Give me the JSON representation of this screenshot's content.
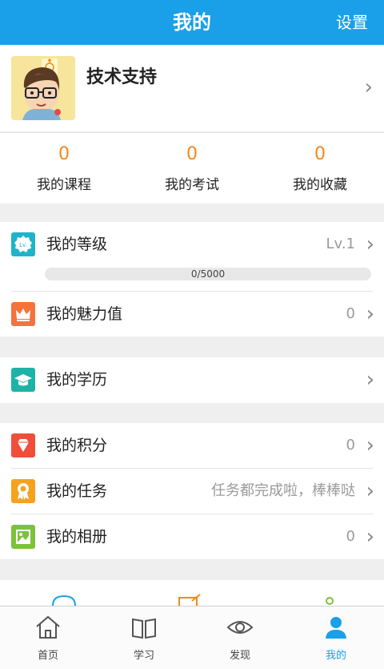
{
  "header": {
    "title": "我的",
    "settings_label": "设置"
  },
  "profile": {
    "name": "技术支持"
  },
  "stats": [
    {
      "value": "0",
      "label": "我的课程"
    },
    {
      "value": "0",
      "label": "我的考试"
    },
    {
      "value": "0",
      "label": "我的收藏"
    }
  ],
  "level": {
    "label": "我的等级",
    "value": "Lv.1",
    "progress_text": "0/5000",
    "progress_fraction": 0
  },
  "charm": {
    "label": "我的魅力值",
    "value": "0"
  },
  "education": {
    "label": "我的学历"
  },
  "points": {
    "label": "我的积分",
    "value": "0"
  },
  "tasks": {
    "label": "我的任务",
    "value": "任务都完成啦，棒棒哒"
  },
  "album": {
    "label": "我的相册",
    "value": "0"
  },
  "tabbar": [
    {
      "label": "首页",
      "icon": "home-icon"
    },
    {
      "label": "学习",
      "icon": "book-icon"
    },
    {
      "label": "发现",
      "icon": "eye-icon"
    },
    {
      "label": "我的",
      "icon": "user-icon",
      "active": true
    }
  ],
  "colors": {
    "accent": "#19a0e8",
    "stat_number": "#f08a1a"
  }
}
